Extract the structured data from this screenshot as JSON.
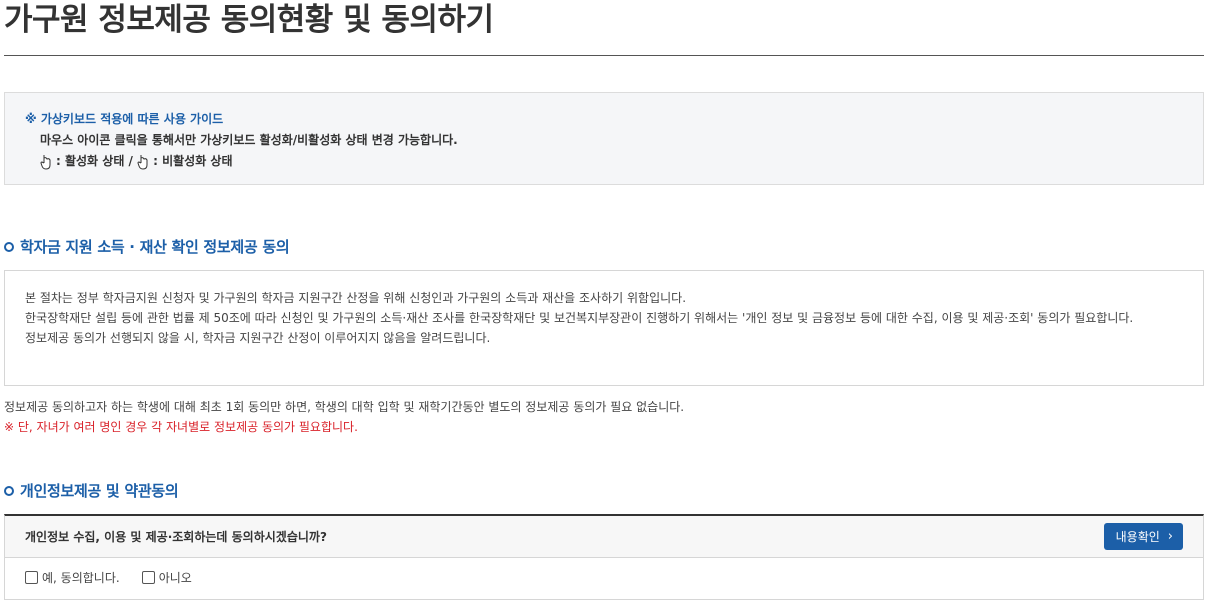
{
  "page": {
    "title": "가구원 정보제공 동의현황 및 동의하기"
  },
  "guide": {
    "title": "※ 가상키보드 적용에 따른 사용 가이드",
    "line1": "마우스 아이콘 클릭을 통해서만 가상키보드 활성화/비활성화 상태 변경 가능합니다.",
    "active_label": ": 활성화 상태 /",
    "inactive_label": ": 비활성화 상태"
  },
  "section1": {
    "title": "학자금 지원 소득 · 재산 확인 정보제공 동의",
    "paragraph1": "본 절차는 정부 학자금지원 신청자 및 가구원의 학자금 지원구간 산정을 위해 신청인과 가구원의 소득과 재산을 조사하기 위함입니다.",
    "paragraph2": "한국장학재단 설립 등에 관한 법률 제 50조에 따라 신청인 및 가구원의 소득·재산 조사를 한국장학재단 및 보건복지부장관이 진행하기 위해서는 '개인 정보 및 금융정보 등에 대한 수집, 이용 및 제공·조회' 동의가 필요합니다.",
    "paragraph3": "정보제공 동의가 선행되지 않을 시, 학자금 지원구간 산정이 이루어지지 않음을 알려드립니다."
  },
  "notes": {
    "note1": "정보제공 동의하고자 하는 학생에 대해 최초 1회 동의만 하면, 학생의 대학 입학 및 재학기간동안 별도의 정보제공 동의가 필요 없습니다.",
    "warning": "※ 단, 자녀가 여러 명인 경우 각 자녀별로 정보제공 동의가 필요합니다."
  },
  "section2": {
    "title": "개인정보제공 및 약관동의",
    "question": "개인정보 수집, 이용 및 제공·조회하는데 동의하시겠습니까?",
    "confirm_button": "내용확인",
    "option_yes": "예, 동의합니다.",
    "option_no": "아니오"
  },
  "colors": {
    "accent": "#1c5fa8",
    "warning": "#d9222a"
  },
  "icons": {
    "guide_active": "mouse-pointer-icon",
    "guide_inactive": "mouse-pointer-icon",
    "section_bullet": "circle-bullet-icon",
    "button_arrow": "chevron-right-icon"
  }
}
